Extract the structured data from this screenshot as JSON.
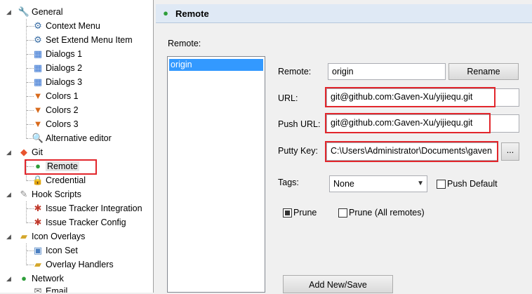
{
  "tree": {
    "general": "General",
    "context_menu": "Context Menu",
    "set_extend_menu_item": "Set Extend Menu Item",
    "dialogs1": "Dialogs 1",
    "dialogs2": "Dialogs 2",
    "dialogs3": "Dialogs 3",
    "colors1": "Colors 1",
    "colors2": "Colors 2",
    "colors3": "Colors 3",
    "alternative_editor": "Alternative editor",
    "git": "Git",
    "remote": "Remote",
    "credential": "Credential",
    "hook_scripts": "Hook Scripts",
    "issue_tracker_integration": "Issue Tracker Integration",
    "issue_tracker_config": "Issue Tracker Config",
    "icon_overlays": "Icon Overlays",
    "icon_set": "Icon Set",
    "overlay_handlers": "Overlay Handlers",
    "network": "Network",
    "email": "Email"
  },
  "panel": {
    "title": "Remote",
    "remote_list_label": "Remote:",
    "remotes": [
      "origin"
    ],
    "remote_label": "Remote:",
    "remote_value": "origin",
    "rename_button": "Rename",
    "url_label": "URL:",
    "url_value": "git@github.com:Gaven-Xu/yijiequ.git",
    "push_url_label": "Push URL:",
    "push_url_value": "git@github.com:Gaven-Xu/yijiequ.git",
    "putty_key_label": "Putty Key:",
    "putty_key_value": "C:\\Users\\Administrator\\Documents\\gaven",
    "browse_button": "...",
    "tags_label": "Tags:",
    "tags_value": "None",
    "push_default_label": "Push Default",
    "push_default_checked": false,
    "prune_label": "Prune",
    "prune_checked": true,
    "prune_all_label": "Prune (All remotes)",
    "prune_all_checked": false,
    "add_new_save_button": "Add New/Save"
  },
  "colors": {
    "highlight_box": "#e2262c",
    "selection": "#3399ff",
    "header_bg": "#dfe9f5"
  }
}
